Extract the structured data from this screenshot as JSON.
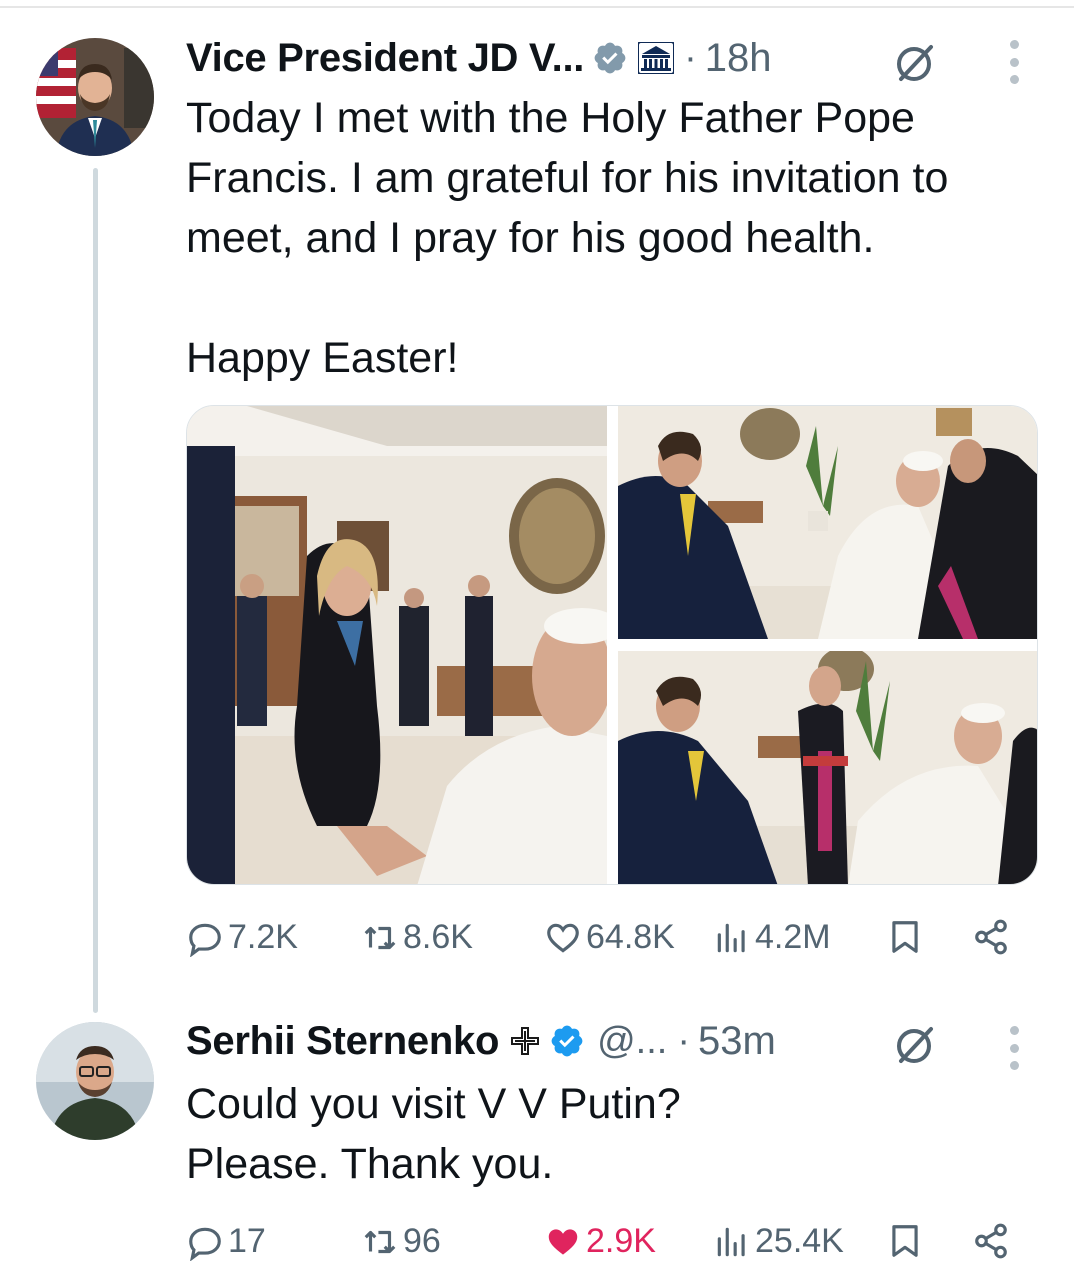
{
  "tweet": {
    "author_name": "Vice President JD V...",
    "time": "18h",
    "separator": "·",
    "text_lines": [
      "Today I met with the Holy Father Pope",
      "Francis. I am grateful for his invitation to",
      "meet, and I pray for his good health."
    ],
    "text_line_2": "Happy Easter!",
    "stats": {
      "replies": "7.2K",
      "reposts": "8.6K",
      "likes": "64.8K",
      "views": "4.2M"
    }
  },
  "reply": {
    "author_name": "Serhii Sternenko",
    "handle": "@...",
    "time": "53m",
    "separator": "·",
    "text_lines": [
      "Could you visit V V Putin?",
      "Please. Thank you."
    ],
    "stats": {
      "replies": "17",
      "reposts": "96",
      "likes": "2.9K",
      "views": "25.4K"
    }
  },
  "icons": {
    "verified": "verified-badge-icon",
    "affiliation": "white-house-affiliation-icon",
    "grok": "grok-icon",
    "more": "more-options-icon",
    "reply": "reply-icon",
    "repost": "repost-icon",
    "like": "like-icon",
    "views": "views-icon",
    "bookmark": "bookmark-icon",
    "share": "share-icon"
  },
  "colors": {
    "text": "#0f1419",
    "secondary": "#536471",
    "verified": "#1d9bf0",
    "like_active": "#e0245e",
    "thread_line": "#cfd9de"
  }
}
